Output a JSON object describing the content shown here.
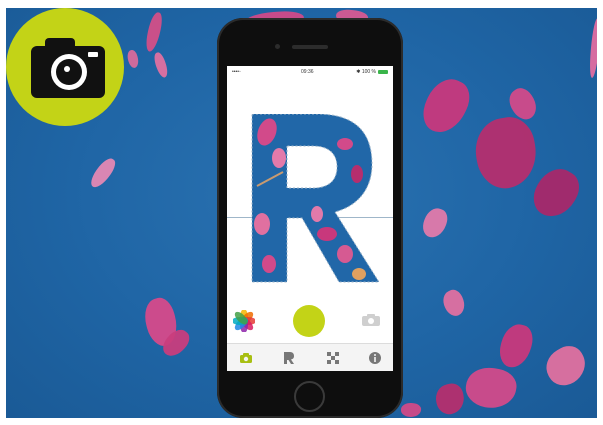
{
  "badge": {
    "icon": "camera-icon",
    "color": "#c3d317"
  },
  "phone": {
    "status_bar": {
      "left": "••••◦",
      "time": "09:36",
      "right": "✱ 100 %"
    },
    "main_letter": "R",
    "controls": {
      "photos_icon": "photos-icon",
      "shutter_icon": "shutter-button",
      "switch_camera_icon": "camera-switch-icon"
    },
    "tabs": [
      {
        "icon": "camera-icon",
        "active": true
      },
      {
        "icon": "letter-icon",
        "active": false
      },
      {
        "icon": "frame-icon",
        "active": false
      },
      {
        "icon": "info-icon",
        "active": false
      }
    ]
  },
  "colors": {
    "accent": "#c3d317",
    "sky": "#1f65a5",
    "petal": "#d44a86"
  }
}
